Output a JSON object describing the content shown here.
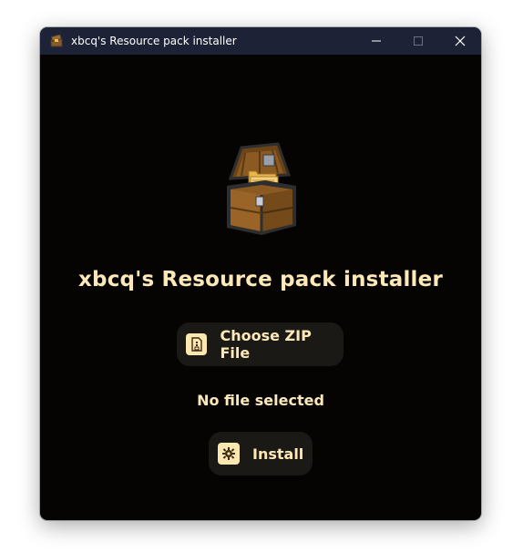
{
  "window": {
    "title": "xbcq's Resource pack installer",
    "controls": {
      "minimize_icon": "minimize-icon",
      "maximize_icon": "maximize-icon",
      "close_icon": "close-icon"
    }
  },
  "main": {
    "logo_icon": "treasure-chest-icon",
    "heading": "xbcq's Resource pack installer",
    "choose_button": {
      "label": "Choose ZIP File",
      "icon": "zip-file-icon"
    },
    "status_text": "No file selected",
    "install_button": {
      "label": "Install",
      "icon": "gear-icon"
    }
  },
  "colors": {
    "titlebar_bg": "#1e2236",
    "content_bg": "#050403",
    "accent_text": "#fde8b8",
    "button_bg": "#1b1916",
    "icon_bg": "#fde7b0"
  }
}
